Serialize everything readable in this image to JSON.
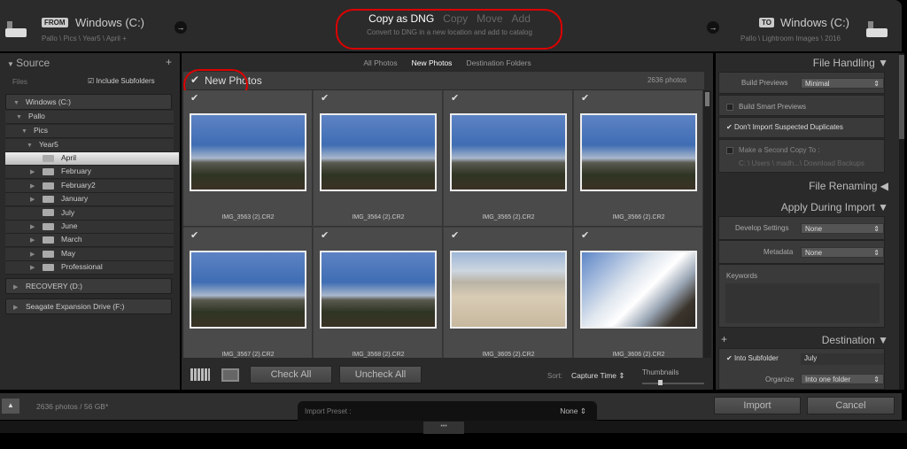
{
  "header": {
    "from_label": "FROM",
    "from_drive": "Windows (C:)",
    "from_path": "Pallo \\ Pics \\ Year5 \\ April +",
    "modes": [
      "Copy as DNG",
      "Copy",
      "Move",
      "Add"
    ],
    "mode_desc": "Convert to DNG in a new location and add to catalog",
    "to_label": "TO",
    "to_drive": "Windows (C:)",
    "to_path": "Pallo \\ Lightroom Images \\ 2016",
    "arrow": "→"
  },
  "source": {
    "title": "Source",
    "plus": "+",
    "files": "Files",
    "include_subfolders": "Include Subfolders",
    "volumes": [
      "Windows (C:)",
      "RECOVERY (D:)",
      "Seagate Expansion Drive (F:)"
    ],
    "tree": [
      "Pallo",
      "Pics",
      "Year5"
    ],
    "folders": [
      {
        "name": "April",
        "selected": true,
        "expand": false
      },
      {
        "name": "February",
        "expand": true
      },
      {
        "name": "February2",
        "expand": true
      },
      {
        "name": "January",
        "expand": true
      },
      {
        "name": "July",
        "expand": false
      },
      {
        "name": "June",
        "expand": true
      },
      {
        "name": "March",
        "expand": true
      },
      {
        "name": "May",
        "expand": true
      },
      {
        "name": "Professional",
        "expand": true
      }
    ]
  },
  "center": {
    "tabs": [
      "All Photos",
      "New Photos",
      "Destination Folders"
    ],
    "active_tab": "New Photos",
    "group_title": "New Photos",
    "count": "2636 photos",
    "photos": [
      {
        "name": "IMG_3563 (2).CR2",
        "type": "mountain"
      },
      {
        "name": "IMG_3564 (2).CR2",
        "type": "mountain"
      },
      {
        "name": "IMG_3565 (2).CR2",
        "type": "mountain"
      },
      {
        "name": "IMG_3566 (2).CR2",
        "type": "mountain"
      },
      {
        "name": "IMG_3567 (2).CR2",
        "type": "mountain"
      },
      {
        "name": "IMG_3568 (2).CR2",
        "type": "mountain"
      },
      {
        "name": "IMG_3605 (2).CR2",
        "type": "desert"
      },
      {
        "name": "IMG_3606 (2).CR2",
        "type": "cloud"
      }
    ],
    "check_all": "Check All",
    "uncheck_all": "Uncheck All",
    "sort_label": "Sort:",
    "sort_value": "Capture Time",
    "thumbnails": "Thumbnails"
  },
  "right": {
    "file_handling": "File Handling",
    "build_previews_label": "Build Previews",
    "build_previews": "Minimal",
    "smart_previews": "Build Smart Previews",
    "no_duplicates": "Don't Import Suspected Duplicates",
    "second_copy": "Make a Second Copy To :",
    "second_copy_path": "C: \\ Users \\ madh...\\ Download Backups",
    "file_renaming": "File Renaming",
    "apply": "Apply During Import",
    "develop_label": "Develop Settings",
    "develop": "None",
    "metadata_label": "Metadata",
    "metadata": "None",
    "keywords": "Keywords",
    "destination": "Destination",
    "plus": "+",
    "into_subfolder": "Into Subfolder",
    "subfolder": "July",
    "organize_label": "Organize",
    "organize": "Into one folder"
  },
  "bottom": {
    "status": "2636 photos / 56 GB*",
    "preset_label": "Import Preset :",
    "preset": "None",
    "import": "Import",
    "cancel": "Cancel",
    "handle": "•••"
  }
}
